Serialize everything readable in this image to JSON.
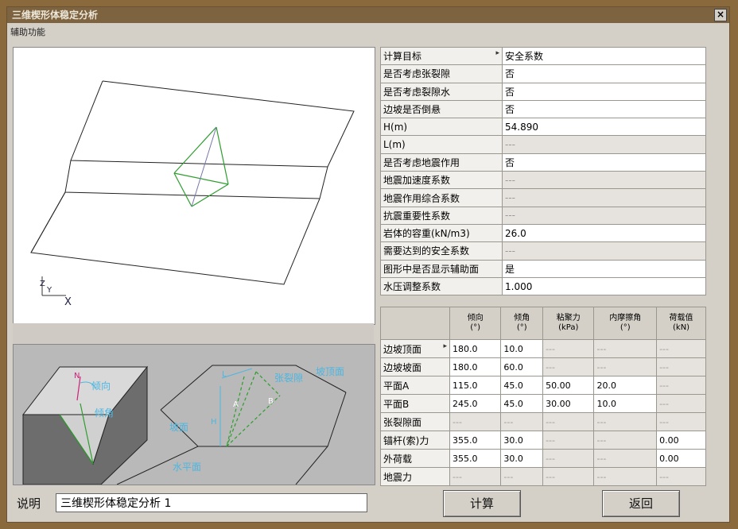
{
  "window": {
    "title": "三维楔形体稳定分析",
    "close_label": "×"
  },
  "menu": {
    "label": "辅助功能"
  },
  "view3d": {
    "axis_x": "X",
    "axis_z": "Z",
    "axis_y": "Y"
  },
  "diagram": {
    "label_dip_dir": "倾向",
    "label_dip": "倾角",
    "label_n": "N",
    "label_tension_crack": "张裂隙",
    "label_top": "坡顶面",
    "label_slope": "坡面",
    "label_horizontal": "水平面",
    "label_l": "L",
    "label_h": "H",
    "label_a": "A",
    "label_b": "B"
  },
  "props": [
    {
      "key": "计算目标",
      "value": "安全系数",
      "dropdown": true
    },
    {
      "key": "是否考虑张裂隙",
      "value": "否"
    },
    {
      "key": "是否考虑裂隙水",
      "value": "否"
    },
    {
      "key": "边坡是否倒悬",
      "value": "否"
    },
    {
      "key": "H(m)",
      "value": "54.890"
    },
    {
      "key": "L(m)",
      "value": "---",
      "disabled": true
    },
    {
      "key": "是否考虑地震作用",
      "value": "否"
    },
    {
      "key": "地震加速度系数",
      "value": "---",
      "disabled": true
    },
    {
      "key": "地震作用综合系数",
      "value": "---",
      "disabled": true
    },
    {
      "key": "抗震重要性系数",
      "value": "---",
      "disabled": true
    },
    {
      "key": "岩体的容重(kN/m3)",
      "value": "26.0"
    },
    {
      "key": "需要达到的安全系数",
      "value": "---",
      "disabled": true
    },
    {
      "key": "图形中是否显示辅助面",
      "value": "是"
    },
    {
      "key": "水压调整系数",
      "value": "1.000"
    }
  ],
  "grid": {
    "headers": [
      "",
      "倾向\n(°)",
      "倾角\n(°)",
      "粘聚力\n(kPa)",
      "内摩擦角\n(°)",
      "荷载值\n(kN)"
    ],
    "rows": [
      {
        "label": "边坡顶面",
        "dropdown": true,
        "cells": [
          "180.0",
          "10.0",
          "---",
          "---",
          "---"
        ]
      },
      {
        "label": "边坡坡面",
        "cells": [
          "180.0",
          "60.0",
          "---",
          "---",
          "---"
        ]
      },
      {
        "label": "平面A",
        "cells": [
          "115.0",
          "45.0",
          "50.00",
          "20.0",
          "---"
        ]
      },
      {
        "label": "平面B",
        "cells": [
          "245.0",
          "45.0",
          "30.00",
          "10.0",
          "---"
        ]
      },
      {
        "label": "张裂隙面",
        "cells": [
          "---",
          "---",
          "---",
          "---",
          "---"
        ]
      },
      {
        "label": "锚杆(索)力",
        "cells": [
          "355.0",
          "30.0",
          "---",
          "---",
          "0.00"
        ]
      },
      {
        "label": "外荷载",
        "cells": [
          "355.0",
          "30.0",
          "---",
          "---",
          "0.00"
        ]
      },
      {
        "label": "地震力",
        "cells": [
          "---",
          "---",
          "---",
          "---",
          "---"
        ]
      }
    ]
  },
  "footer": {
    "desc_label": "说明",
    "desc_value": "三维楔形体稳定分析 1",
    "calc_label": "计算",
    "back_label": "返回"
  }
}
